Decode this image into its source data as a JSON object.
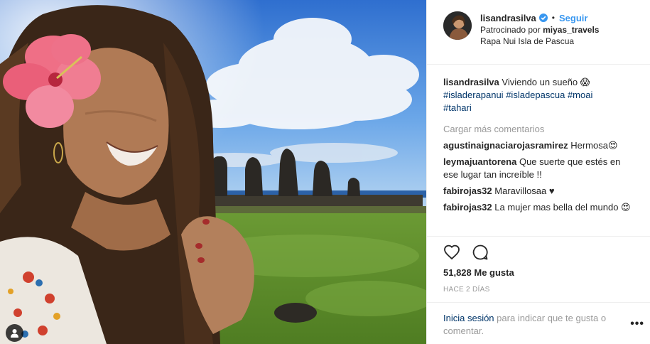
{
  "post": {
    "username": "lisandrasilva",
    "follow_label": "Seguir",
    "separator": "•",
    "sponsored_prefix": "Patrocinado por",
    "sponsor": "miyas_travels",
    "location": "Rapa Nui Isla de Pascua"
  },
  "caption": {
    "user": "lisandrasilva",
    "text": "Viviendo un sueño 😱",
    "tag1": "#isladerapanui",
    "tag2": "#isladepascua",
    "tag3": "#moai",
    "tag4": "#tahari"
  },
  "load_more": "Cargar más comentarios",
  "comments": [
    {
      "user": "agustinaignaciarojasramirez",
      "text": "Hermosa😍"
    },
    {
      "user": "leymajuantorena",
      "text": "Que suerte que estés en ese lugar tan increíble !!"
    },
    {
      "user": "fabirojas32",
      "text": "Maravillosaa ♥"
    },
    {
      "user": "fabirojas32",
      "text": "La mujer mas bella del mundo 😍"
    }
  ],
  "likes": "51,828 Me gusta",
  "time": "HACE 2 DÍAS",
  "login": {
    "link": "Inicia sesión",
    "text": "para indicar que te gusta o comentar."
  },
  "options_label": "•••",
  "icons": [
    "heart-icon",
    "comment-icon",
    "verified-icon",
    "user-tag-icon"
  ],
  "colors": {
    "link": "#003569",
    "follow": "#3897f0",
    "muted": "#999999"
  }
}
